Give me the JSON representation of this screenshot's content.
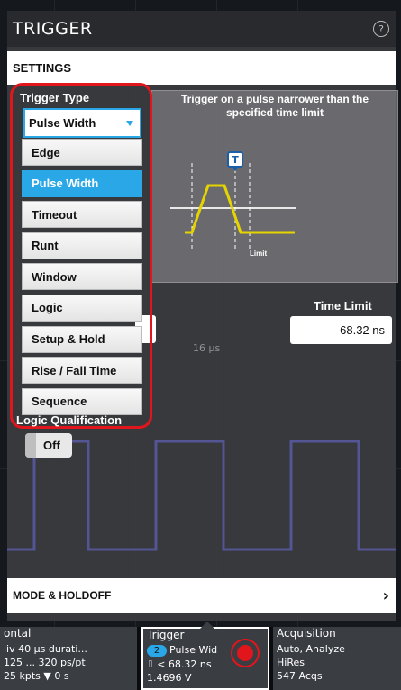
{
  "panel": {
    "title": "TRIGGER",
    "help_glyph": "?",
    "settings_label": "SETTINGS"
  },
  "trigger_type": {
    "label": "Trigger Type",
    "selected": "Pulse Width",
    "options": [
      "Edge",
      "Pulse Width",
      "Timeout",
      "Runt",
      "Window",
      "Logic",
      "Setup & Hold",
      "Rise / Fall Time",
      "Sequence"
    ]
  },
  "diagram": {
    "caption_line1": "Trigger on a pulse narrower than the",
    "caption_line2": "specified time limit",
    "marker_label": "T",
    "limit_label": "Limit"
  },
  "time_limit": {
    "label": "Time Limit",
    "value": "68.32 ns"
  },
  "logic_qualification": {
    "label": "Logic Qualification",
    "toggle_label": "Off"
  },
  "mode_holdoff": {
    "label": "MODE & HOLDOFF"
  },
  "background_text": {
    "time_marker": "16 μs"
  },
  "badges": {
    "horizontal": {
      "title": "ontal",
      "line1": "liv     40 μs durati...",
      "line2": "125 ...  320 ps/pt",
      "line3": "25 kpts  ▼  0 s"
    },
    "trigger": {
      "title": "Trigger",
      "channel": "2",
      "type": "Pulse Wid",
      "condition": "< 68.32 ns",
      "level": "1.4696 V"
    },
    "acquisition": {
      "title": "Acquisition",
      "line1": "Auto,   Analyze",
      "line2": "HiRes",
      "line3": "547 Acqs"
    }
  },
  "colors": {
    "accent_blue": "#2aa7e6",
    "highlight_red": "#e0161c",
    "waveform_yellow": "#e6d400"
  }
}
